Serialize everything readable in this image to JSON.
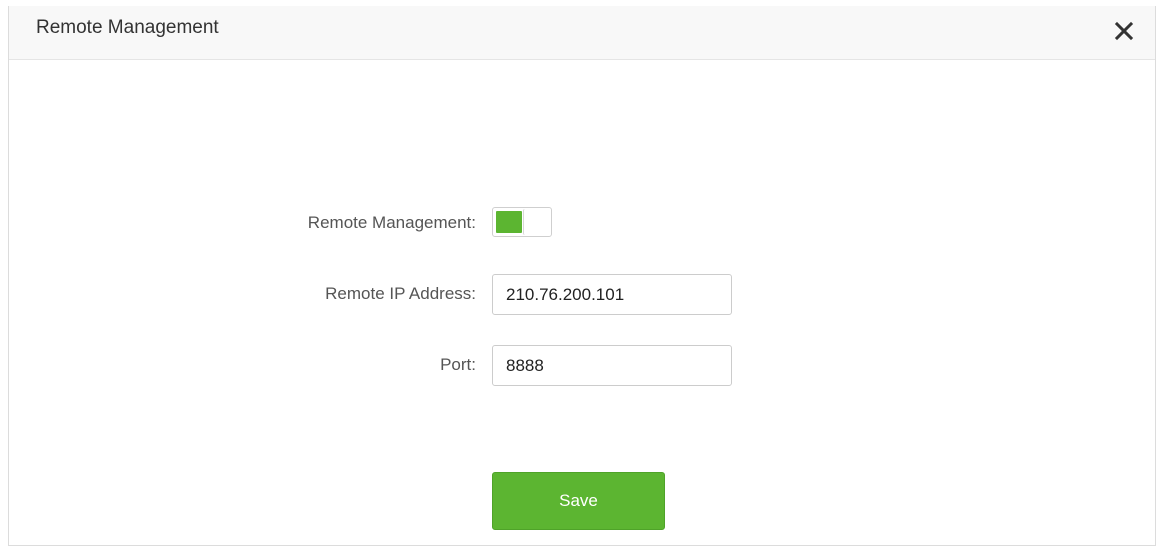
{
  "dialog": {
    "title": "Remote Management",
    "close_icon": "close-icon"
  },
  "form": {
    "remote_management": {
      "label": "Remote Management:",
      "enabled": true,
      "on_color": "#5cb531"
    },
    "remote_ip": {
      "label": "Remote IP Address:",
      "value": "210.76.200.101"
    },
    "port": {
      "label": "Port:",
      "value": "8888"
    }
  },
  "actions": {
    "save_label": "Save",
    "save_color": "#5cb531"
  }
}
